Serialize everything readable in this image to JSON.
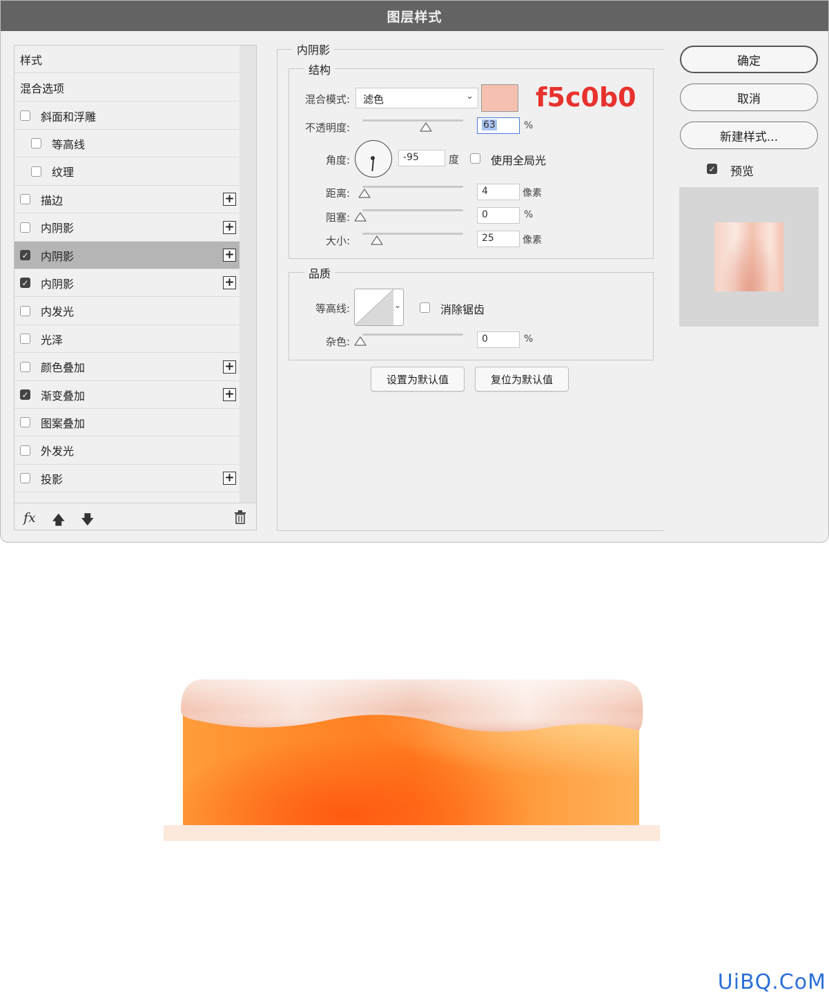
{
  "dialog": {
    "title": "图层样式",
    "styles_header": "样式",
    "blend_options": "混合选项",
    "effects": [
      {
        "label": "斜面和浮雕",
        "checked": false,
        "indent": 0,
        "plus": false
      },
      {
        "label": "等高线",
        "checked": false,
        "indent": 1,
        "plus": false
      },
      {
        "label": "纹理",
        "checked": false,
        "indent": 1,
        "plus": false
      },
      {
        "label": "描边",
        "checked": false,
        "indent": 0,
        "plus": true
      },
      {
        "label": "内阴影",
        "checked": false,
        "indent": 0,
        "plus": true
      },
      {
        "label": "内阴影",
        "checked": true,
        "indent": 0,
        "plus": true,
        "selected": true
      },
      {
        "label": "内阴影",
        "checked": true,
        "indent": 0,
        "plus": true
      },
      {
        "label": "内发光",
        "checked": false,
        "indent": 0,
        "plus": false
      },
      {
        "label": "光泽",
        "checked": false,
        "indent": 0,
        "plus": false
      },
      {
        "label": "颜色叠加",
        "checked": false,
        "indent": 0,
        "plus": true
      },
      {
        "label": "渐变叠加",
        "checked": true,
        "indent": 0,
        "plus": true
      },
      {
        "label": "图案叠加",
        "checked": false,
        "indent": 0,
        "plus": false
      },
      {
        "label": "外发光",
        "checked": false,
        "indent": 0,
        "plus": false
      },
      {
        "label": "投影",
        "checked": false,
        "indent": 0,
        "plus": true
      }
    ],
    "footer": {
      "fx": "fx",
      "up_icon": "arrow-up-icon",
      "down_icon": "arrow-down-icon",
      "trash_icon": "trash-icon"
    }
  },
  "panel": {
    "section_title": "内阴影",
    "structure": {
      "title": "结构",
      "blend_mode_label": "混合模式:",
      "blend_mode_value": "滤色",
      "shadow_color": "#f5c0b0",
      "color_note": "f5c0b0",
      "opacity_label": "不透明度:",
      "opacity_value": "63",
      "opacity_unit": "%",
      "opacity_fraction": 0.63,
      "angle_label": "角度:",
      "angle_value": "-95",
      "angle_unit": "度",
      "global_light_label": "使用全局光",
      "distance_label": "距离:",
      "distance_value": "4",
      "distance_unit": "像素",
      "choke_label": "阻塞:",
      "choke_value": "0",
      "choke_unit": "%",
      "size_label": "大小:",
      "size_value": "25",
      "size_unit": "像素"
    },
    "quality": {
      "title": "品质",
      "contour_label": "等高线:",
      "anti_alias_label": "消除锯齿",
      "noise_label": "杂色:",
      "noise_value": "0",
      "noise_unit": "%"
    },
    "buttons": {
      "set_default": "设置为默认值",
      "reset_default": "复位为默认值"
    }
  },
  "right": {
    "ok": "确定",
    "cancel": "取消",
    "new_style": "新建样式...",
    "preview_label": "预览",
    "preview_checked": true
  },
  "watermark": "UiBQ.CoM"
}
